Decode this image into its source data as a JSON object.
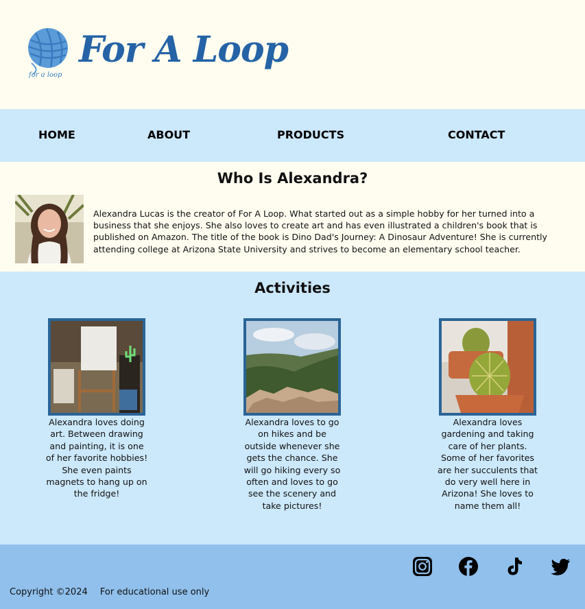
{
  "brand": {
    "logo_small_text": "for a loop",
    "name": "For A Loop"
  },
  "nav": {
    "items": [
      {
        "label": "HOME"
      },
      {
        "label": "ABOUT"
      },
      {
        "label": "PRODUCTS"
      },
      {
        "label": "CONTACT"
      }
    ]
  },
  "about": {
    "title": "Who Is Alexandra?",
    "text": "Alexandra Lucas is the creator of For A Loop. What started out as a simple hobby for her turned into a business that she enjoys. She also loves to create art and has even illustrated a children's book that is published on Amazon. The title of the book is Dino Dad's Journey: A Dinosaur Adventure! She is currently attending college at Arizona State University and strives to become an elementary school teacher."
  },
  "activities": {
    "title": "Activities",
    "cards": [
      {
        "text": "Alexandra loves doing art. Between drawing and painting, it is one of her favorite hobbies! She even paints magnets to hang up on the fridge!"
      },
      {
        "text": "Alexandra loves to go on hikes and be outside whenever she gets the chance. She will go hiking every so often and loves to go see the scenery and take pictures!"
      },
      {
        "text": "Alexandra loves gardening and taking care of her plants. Some of her favorites are her succulents that do very well here in Arizona! She loves to name them all!"
      }
    ]
  },
  "footer": {
    "copyright": "Copyright ©2024",
    "note": "For educational use only",
    "social": [
      "instagram-icon",
      "facebook-icon",
      "tiktok-icon",
      "twitter-icon"
    ]
  },
  "colors": {
    "cream": "#fffdf0",
    "light_blue": "#cce8fb",
    "footer_blue": "#90c0eb",
    "brand_blue": "#2563a6"
  }
}
